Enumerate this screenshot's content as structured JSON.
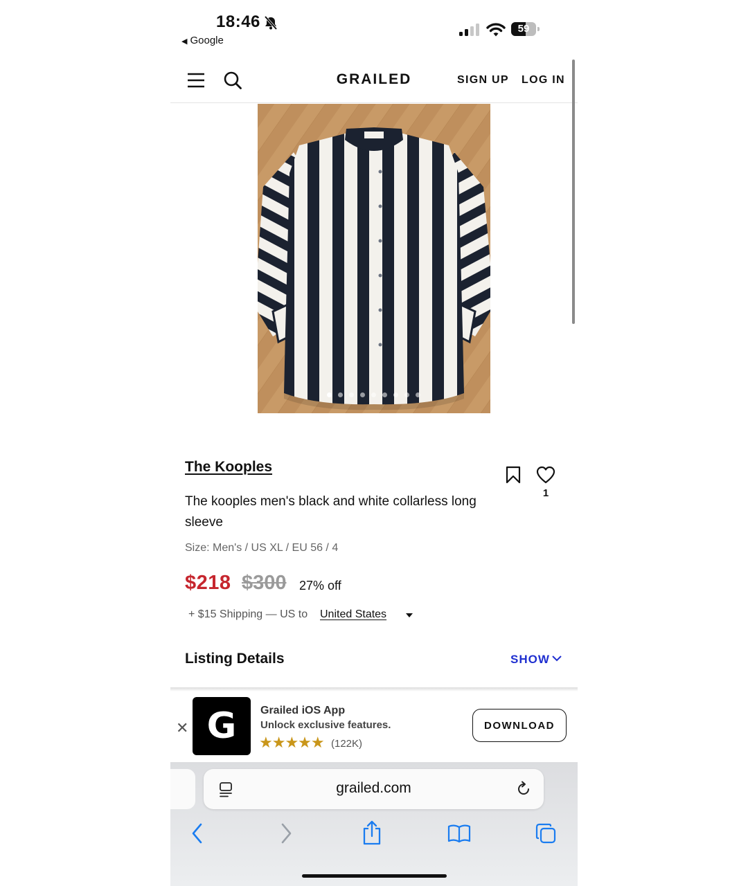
{
  "status_bar": {
    "time": "18:46",
    "back_app": "Google",
    "battery": "59",
    "battery_level": 0.59
  },
  "header": {
    "logo": "GRAILED",
    "sign_up": "SIGN UP",
    "log_in": "LOG IN"
  },
  "gallery": {
    "image_count": 9,
    "active_index": 0
  },
  "product": {
    "brand": "The Kooples",
    "title": "The kooples men's black and white collarless long sleeve",
    "size": "Size: Men's / US XL / EU 56 / 4",
    "price": "$218",
    "original_price": "$300",
    "discount": "27% off",
    "shipping": "+ $15 Shipping — US to",
    "country": "United States",
    "favorites": "1"
  },
  "listing_details": {
    "label": "Listing Details",
    "toggle": "SHOW"
  },
  "app_banner": {
    "close": "✕",
    "icon_letter": "G",
    "name": "Grailed iOS App",
    "tagline": "Unlock exclusive features.",
    "stars": "★★★★★",
    "reviews": "(122K)",
    "button": "DOWNLOAD"
  },
  "browser": {
    "url": "grailed.com"
  },
  "colors": {
    "price": "#c6262e",
    "link_blue": "#1f2fd0",
    "ios_blue": "#1a7cf0",
    "star_gold": "#c9961a"
  }
}
